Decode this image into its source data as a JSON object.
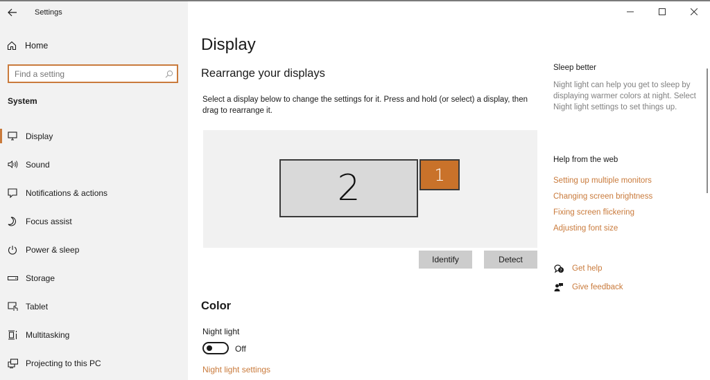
{
  "window": {
    "title": "Settings",
    "controls": {
      "minimize": "minimize",
      "maximize": "maximize",
      "close": "close"
    }
  },
  "sidebar": {
    "back_icon": "back-arrow-icon",
    "home_label": "Home",
    "search": {
      "placeholder": "Find a setting",
      "value": ""
    },
    "section_label": "System",
    "items": [
      {
        "label": "Display",
        "icon": "monitor-icon",
        "active": true
      },
      {
        "label": "Sound",
        "icon": "speaker-icon",
        "active": false
      },
      {
        "label": "Notifications & actions",
        "icon": "notification-icon",
        "active": false
      },
      {
        "label": "Focus assist",
        "icon": "moon-icon",
        "active": false
      },
      {
        "label": "Power & sleep",
        "icon": "power-icon",
        "active": false
      },
      {
        "label": "Storage",
        "icon": "storage-icon",
        "active": false
      },
      {
        "label": "Tablet",
        "icon": "tablet-icon",
        "active": false
      },
      {
        "label": "Multitasking",
        "icon": "multitasking-icon",
        "active": false
      },
      {
        "label": "Projecting to this PC",
        "icon": "projecting-icon",
        "active": false
      }
    ]
  },
  "main": {
    "title": "Display",
    "rearrange": {
      "heading": "Rearrange your displays",
      "description": "Select a display below to change the settings for it. Press and hold (or select) a display, then drag to rearrange it.",
      "displays": [
        {
          "number": "2",
          "selected": false
        },
        {
          "number": "1",
          "selected": true
        }
      ],
      "identify_label": "Identify",
      "detect_label": "Detect"
    },
    "color": {
      "heading": "Color",
      "night_light_label": "Night light",
      "night_light_state": "Off",
      "night_light_on": false,
      "night_light_settings_link": "Night light settings"
    }
  },
  "right_panel": {
    "sleep_heading": "Sleep better",
    "sleep_text": "Night light can help you get to sleep by displaying warmer colors at night. Select Night light settings to set things up.",
    "help_heading": "Help from the web",
    "help_links": [
      "Setting up multiple monitors",
      "Changing screen brightness",
      "Fixing screen flickering",
      "Adjusting font size"
    ],
    "get_help": "Get help",
    "give_feedback": "Give feedback"
  },
  "colors": {
    "accent": "#c97a3b",
    "selected_display": "#c9722a",
    "sidebar_bg": "#f2f2f2"
  }
}
